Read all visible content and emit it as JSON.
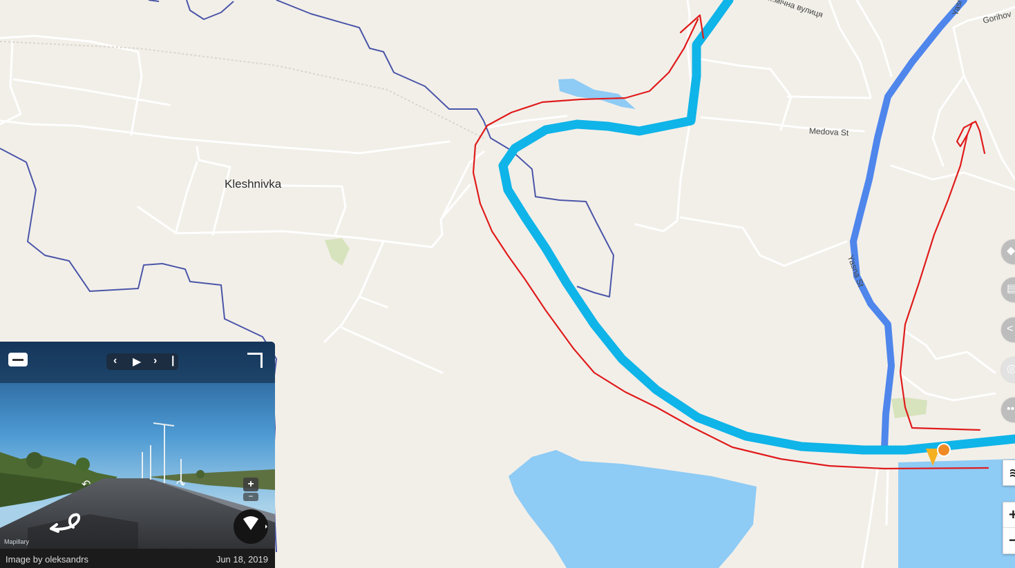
{
  "map": {
    "place_labels": [
      {
        "name": "Kleshnivka"
      }
    ],
    "road_labels": [
      {
        "name": "Medova St"
      },
      {
        "name": "Yasna St"
      },
      {
        "name": "Yasna St"
      },
      {
        "name": "...мічна вулиця"
      },
      {
        "name": "Gorihov"
      }
    ],
    "colors": {
      "land": "#f2efe9",
      "water": "#8ecbf5",
      "road": "#ffffff",
      "boundary": "#4a55a8",
      "route_primary": "#0fb4e8",
      "route_secondary": "#4f86ec",
      "drawn_annotation": "#e01b1b",
      "park": "#d7e3bd",
      "position_marker": "#f08a24"
    }
  },
  "side_buttons": [
    {
      "icon": "tag-icon"
    },
    {
      "icon": "comment-icon"
    },
    {
      "icon": "share-icon"
    },
    {
      "icon": "compass-icon"
    },
    {
      "icon": "more-icon"
    }
  ],
  "map_controls": {
    "layers_icon": "layers-icon",
    "zoom_in_label": "+",
    "zoom_out_label": "−"
  },
  "viewer": {
    "collapse_icon": "minimize-icon",
    "prev_label": "‹",
    "play_label": "▶",
    "next_label": "›",
    "end_label": "|",
    "expand_icon": "expand-icon",
    "zoom_in_label": "+",
    "zoom_out_label": "−",
    "watermark": "Mapillary",
    "credit": "Image by oleksandrs",
    "date": "Jun 18, 2019"
  }
}
